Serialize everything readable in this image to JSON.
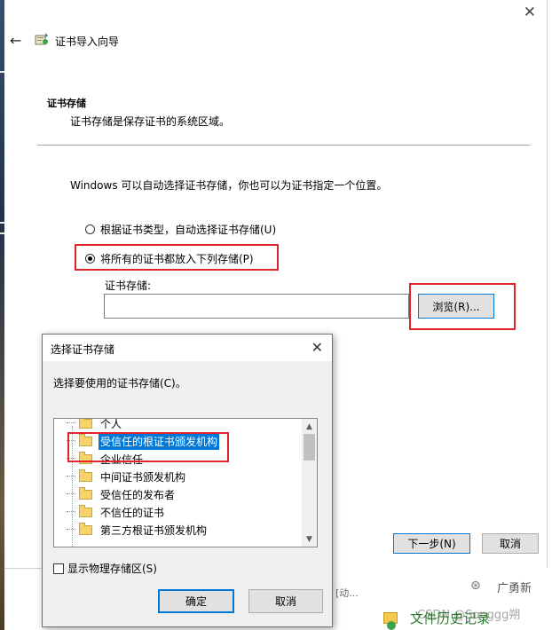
{
  "wizard": {
    "title": "证书导入向导",
    "close_icon": "close-icon",
    "back_icon": "back-arrow-icon",
    "section_title": "证书存储",
    "section_desc": "证书存储是保存证书的系统区域。",
    "intro": "Windows 可以自动选择证书存储，你也可以为证书指定一个位置。",
    "options": [
      {
        "label": "根据证书类型，自动选择证书存储(U)",
        "selected": false
      },
      {
        "label": "将所有的证书都放入下列存储(P)",
        "selected": true
      }
    ],
    "store_label": "证书存储:",
    "store_value": "",
    "browse_label": "浏览(R)...",
    "next_label": "下一步(N)",
    "cancel_label": "取消"
  },
  "dialog": {
    "title": "选择证书存储",
    "prompt": "选择要使用的证书存储(C)。",
    "stores": [
      "个人",
      "受信任的根证书颁发机构",
      "企业信任",
      "中间证书颁发机构",
      "受信任的发布者",
      "不信任的证书",
      "第三方根证书颁发机构"
    ],
    "selected_index": 1,
    "show_physical_label": "显示物理存储区(S)",
    "show_physical_checked": false,
    "ok_label": "确定",
    "cancel_label": "取消"
  },
  "background": {
    "status_text": "[动...",
    "history_text": "文件历史记录",
    "watermark": "CSDN @Songgg朔",
    "brand": "广勇新"
  },
  "colors": {
    "accent": "#0078d7",
    "highlight_box": "#e0242a",
    "selection": "#0078d7"
  }
}
